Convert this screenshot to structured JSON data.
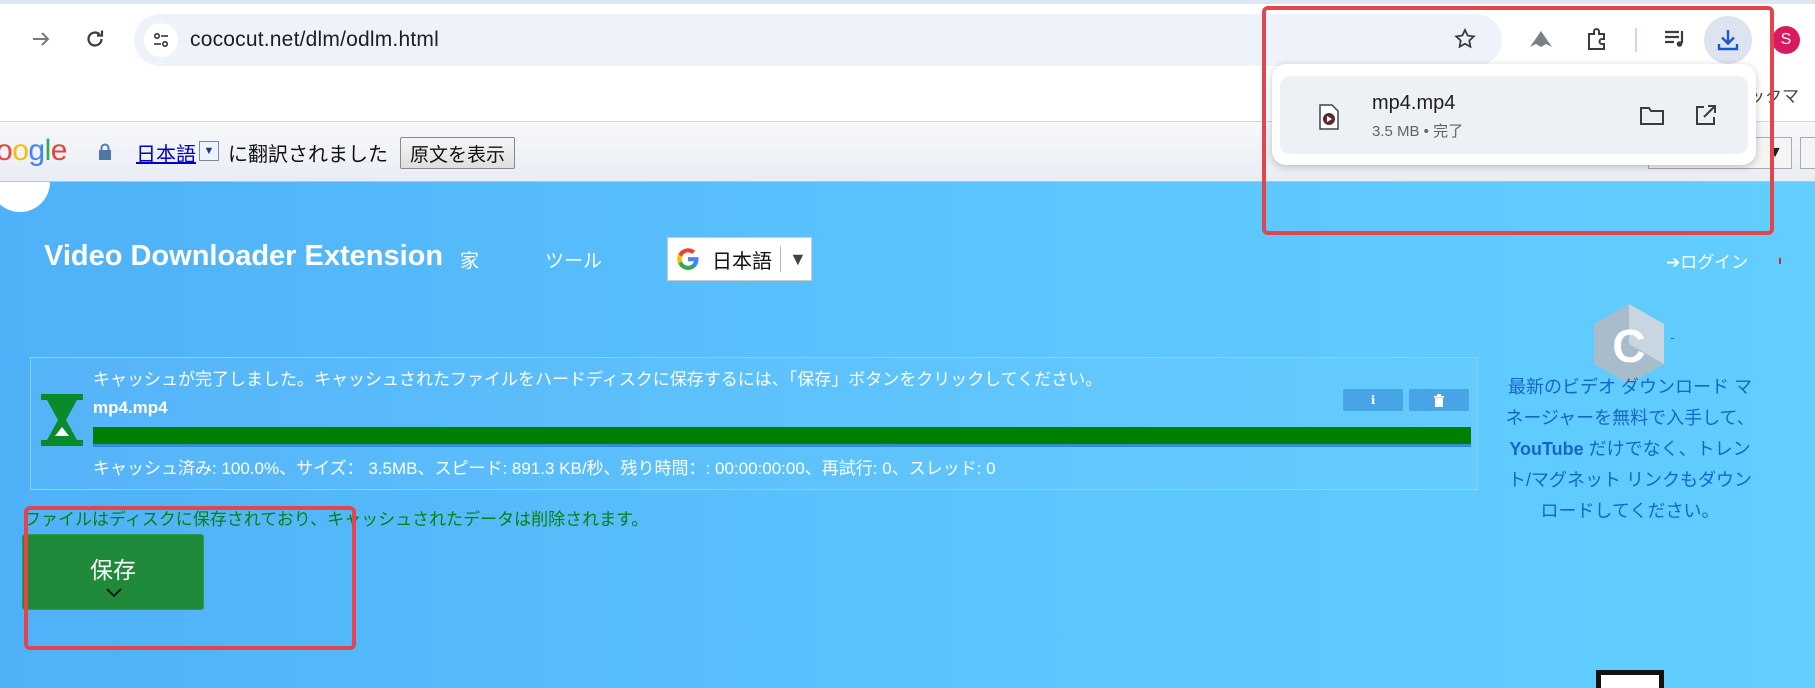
{
  "browser": {
    "url": "cococut.net/dlm/odlm.html",
    "avatar_letter": "S",
    "bookmark_text": "ックマ",
    "accent_color": "#1a57c9"
  },
  "translate_bar": {
    "logo_text": "oogle",
    "language_link": "日本語",
    "message": "に翻訳されました",
    "show_original_button": "原文を表示",
    "right_select_arrow": "▼"
  },
  "site": {
    "title": "Video Downloader Extension",
    "nav": {
      "home": "家",
      "tools": "ツール"
    },
    "language_select": {
      "value": "日本語",
      "arrow": "▼"
    },
    "login_label": "ログイン"
  },
  "cache_panel": {
    "message": "キャッシュが完了しました。キャッシュされたファイルをハードディスクに保存するには、「保存」ボタンをクリックしてください。",
    "filename": "mp4.mp4",
    "progress_percent": 100,
    "progress_color": "#008000",
    "stats": "キャッシュ済み: 100.0%、サイズ： 3.5MB、スピード: 891.3 KB/秒、残り時間：: 00:00:00:00、再試行: 0、スレッド: 0"
  },
  "saved_message": "ファイルはディスクに保存されており、キャッシュされたデータは削除されます。",
  "save_button": {
    "label": "保存"
  },
  "promo": {
    "part1": "最新のビデオ ダウンロード マネージャーを無料で入手して、",
    "brand": "YouTube",
    "part2": " だけでなく、トレント/マグネット リンクもダウンロードしてください。",
    "logo_letter": "C",
    "logo_dash": "-"
  },
  "download_bubble": {
    "filename": "mp4.mp4",
    "status": "3.5 MB • 完了"
  },
  "highlight_color": "#e0464c"
}
